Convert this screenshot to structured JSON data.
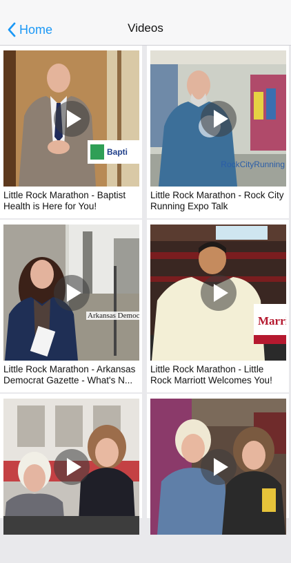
{
  "nav": {
    "back_label": "Home",
    "title": "Videos"
  },
  "videos": [
    {
      "caption": "Little Rock Marathon - Baptist Health is Here for You!",
      "overlay_text": "Bapti"
    },
    {
      "caption": "Little Rock Marathon - Rock City Running Expo Talk",
      "overlay_text": "RockCityRunning"
    },
    {
      "caption": "Little Rock Marathon - Arkansas Democrat Gazette - What's N...",
      "overlay_text": "Arkansas Democr"
    },
    {
      "caption": "Little Rock Marathon - Little Rock Marriott Welcomes You!",
      "overlay_text": "Marri"
    },
    {
      "caption": "",
      "overlay_text": ""
    },
    {
      "caption": "",
      "overlay_text": ""
    }
  ],
  "colors": {
    "accent": "#1b98f5",
    "background": "#e9e9ec"
  },
  "icons": {
    "back": "chevron-left-icon",
    "play": "play-icon"
  }
}
